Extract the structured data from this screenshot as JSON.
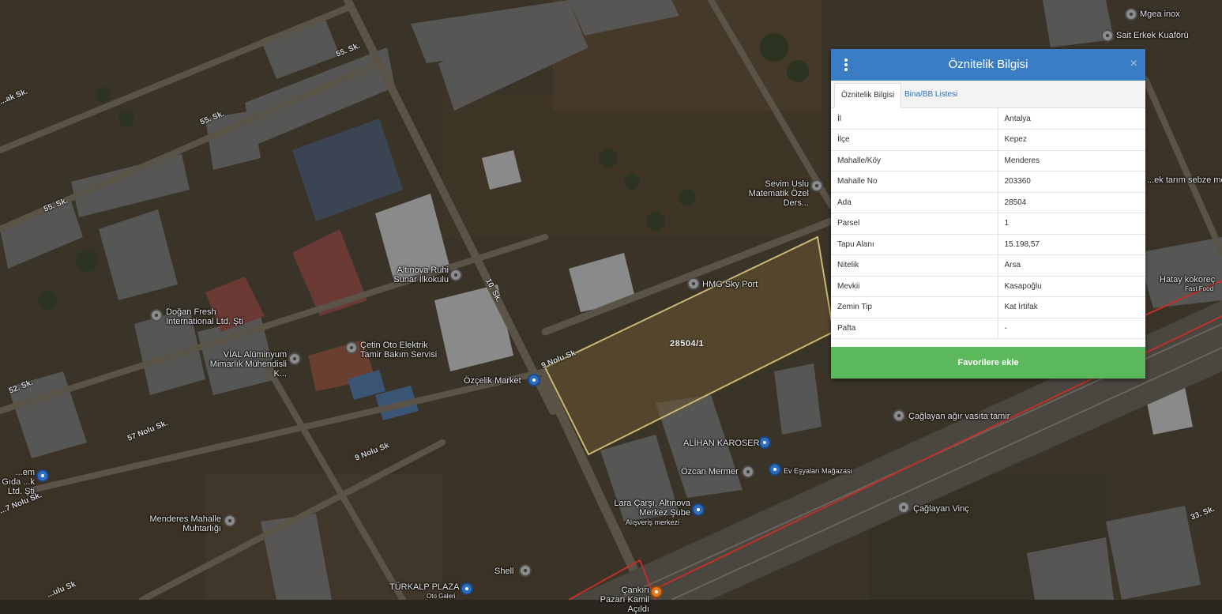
{
  "panel": {
    "title": "Öznitelik Bilgisi",
    "close_label": "×",
    "tabs": [
      {
        "label": "Öznitelik Bilgisi",
        "active": true
      },
      {
        "label": "Bina/BB Listesi",
        "active": false
      }
    ],
    "rows": [
      {
        "key": "İl",
        "value": "Antalya"
      },
      {
        "key": "İlçe",
        "value": "Kepez"
      },
      {
        "key": "Mahalle/Köy",
        "value": "Menderes"
      },
      {
        "key": "Mahalle No",
        "value": "203360"
      },
      {
        "key": "Ada",
        "value": "28504"
      },
      {
        "key": "Parsel",
        "value": "1"
      },
      {
        "key": "Tapu Alanı",
        "value": "15.198,57"
      },
      {
        "key": "Nitelik",
        "value": "Arsa"
      },
      {
        "key": "Mevkii",
        "value": "Kasapoğlu"
      },
      {
        "key": "Zemin Tip",
        "value": "Kat İrtifak"
      },
      {
        "key": "Pafta",
        "value": "-"
      }
    ],
    "favorite_button": "Favorilere ekle"
  },
  "map": {
    "parcel_label": "28504/1",
    "places": [
      "Mgea inox",
      "Sait Erkek Kuaförü",
      "Sevim Uslu Matematik Özel Ders...",
      "Altınova Ruhi Sunar İlkokulu",
      "HMG Sky Port",
      "Doğan Fresh International Ltd. Şti",
      "VİAL Alüminyum Mimarlık Mühendisli K...",
      "Çetin Oto Elektrik Tamir Bakım Servisi",
      "Özçelik Market",
      "ALİHAN KAROSER",
      "Özcan Mermer",
      "Ev Eşyaları Mağazası",
      "Lara Çarşı, Altınova Merkez Şube",
      "Alışveriş merkezi",
      "Menderes Mahalle Muhtarlığı",
      "Shell",
      "TÜRKALP PLAZA",
      "Oto Galeri",
      "Çankırı Pazarı Kamil Açıldı",
      "Çağlayan ağır vasıta tamir",
      "Çağlayan Vinç",
      "Hatay kokoreç",
      "Fast Food",
      "...ek tarım sebze meyve",
      "...em Gıda ...k Ltd. Şti"
    ],
    "streets": [
      "55. Sk.",
      "55. Sk.",
      "55. Sk.",
      "...ak Sk.",
      "10. Sk.",
      "9 Nolu Sk",
      "9 Nolu Sk",
      "57 Nolu Sk.",
      "52. Sk.",
      "...7 Nolu Sk.",
      "33. Sk.",
      "...ulu Sk"
    ]
  }
}
